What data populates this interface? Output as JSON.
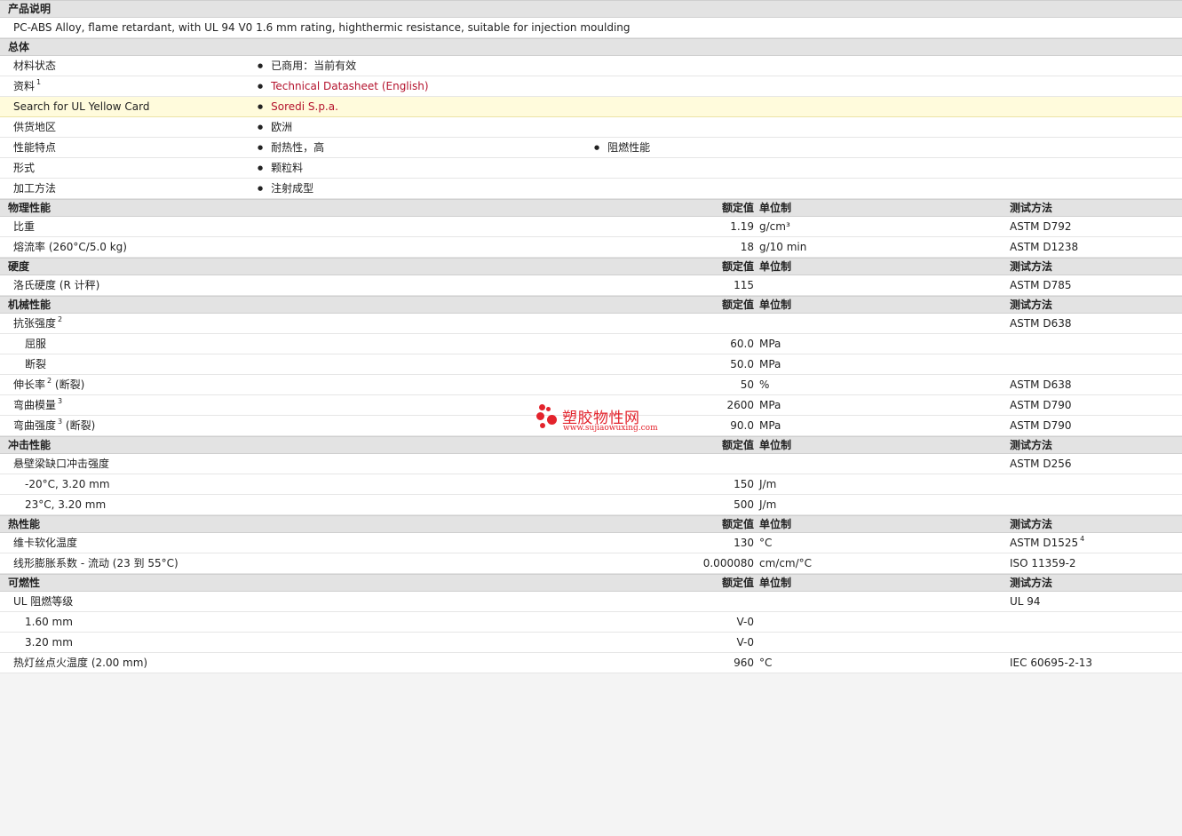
{
  "watermark": {
    "name": "塑胶物性网",
    "url": "www.sujiaowuxing.com"
  },
  "sections": {
    "description": {
      "title": "产品说明",
      "text": "PC-ABS Alloy, flame retardant, with UL 94 V0 1.6 mm rating, highthermic resistance, suitable for injection moulding"
    },
    "general": {
      "title": "总体",
      "rows": [
        {
          "label": "材料状态",
          "items": [
            "已商用：当前有效"
          ]
        },
        {
          "label": "资料",
          "sup": "1",
          "items": [
            "Technical Datasheet (English)"
          ],
          "link": true
        },
        {
          "label": "Search for UL Yellow Card",
          "items": [
            "Soredi S.p.a."
          ],
          "link": true,
          "highlight": true
        },
        {
          "label": "供货地区",
          "items": [
            "欧洲"
          ]
        },
        {
          "label": "性能特点",
          "items": [
            "耐热性，高",
            "阻燃性能"
          ]
        },
        {
          "label": "形式",
          "items": [
            "颗粒料"
          ]
        },
        {
          "label": "加工方法",
          "items": [
            "注射成型"
          ]
        }
      ]
    },
    "header_labels": {
      "value": "额定值",
      "unit": "单位制",
      "test": "测试方法"
    },
    "physical": {
      "title": "物理性能",
      "rows": [
        {
          "label": "比重",
          "value": "1.19",
          "unit": "g/cm³",
          "test": "ASTM D792"
        },
        {
          "label": "熔流率  (260°C/5.0 kg)",
          "value": "18",
          "unit": "g/10 min",
          "test": "ASTM D1238"
        }
      ]
    },
    "hardness": {
      "title": "硬度",
      "rows": [
        {
          "label": "洛氏硬度  (R 计秤)",
          "value": "115",
          "unit": "",
          "test": "ASTM D785"
        }
      ]
    },
    "mechanical": {
      "title": "机械性能",
      "rows": [
        {
          "label": "抗张强度",
          "sup": "2",
          "value": "",
          "unit": "",
          "test": "ASTM D638"
        },
        {
          "label": "屈服",
          "sub": true,
          "value": "60.0",
          "unit": "MPa",
          "test": ""
        },
        {
          "label": "断裂",
          "sub": true,
          "value": "50.0",
          "unit": "MPa",
          "test": ""
        },
        {
          "label": "伸长率",
          "sup": "2",
          "suffix": " (断裂)",
          "value": "50",
          "unit": "%",
          "test": "ASTM D638"
        },
        {
          "label": "弯曲模量",
          "sup": "3",
          "value": "2600",
          "unit": "MPa",
          "test": "ASTM D790"
        },
        {
          "label": "弯曲强度",
          "sup": "3",
          "suffix": " (断裂)",
          "value": "90.0",
          "unit": "MPa",
          "test": "ASTM D790"
        }
      ]
    },
    "impact": {
      "title": "冲击性能",
      "rows": [
        {
          "label": "悬壁梁缺口冲击强度",
          "value": "",
          "unit": "",
          "test": "ASTM D256"
        },
        {
          "label": "-20°C, 3.20 mm",
          "sub": true,
          "value": "150",
          "unit": "J/m",
          "test": ""
        },
        {
          "label": "23°C, 3.20 mm",
          "sub": true,
          "value": "500",
          "unit": "J/m",
          "test": ""
        }
      ]
    },
    "thermal": {
      "title": "热性能",
      "rows": [
        {
          "label": "维卡软化温度",
          "value": "130",
          "unit": "°C",
          "test": "ASTM D1525",
          "testsup": "4"
        },
        {
          "label": "线形膨胀系数  - 流动  (23 到  55°C)",
          "value": "0.000080",
          "unit": "cm/cm/°C",
          "test": "ISO 11359-2"
        }
      ]
    },
    "flammability": {
      "title": "可燃性",
      "rows": [
        {
          "label": "UL 阻燃等级",
          "value": "",
          "unit": "",
          "test": "UL 94"
        },
        {
          "label": "1.60 mm",
          "sub": true,
          "value": "V-0",
          "unit": "",
          "test": ""
        },
        {
          "label": "3.20 mm",
          "sub": true,
          "value": "V-0",
          "unit": "",
          "test": ""
        },
        {
          "label": "热灯丝点火温度  (2.00 mm)",
          "value": "960",
          "unit": "°C",
          "test": "IEC 60695-2-13"
        }
      ]
    }
  }
}
